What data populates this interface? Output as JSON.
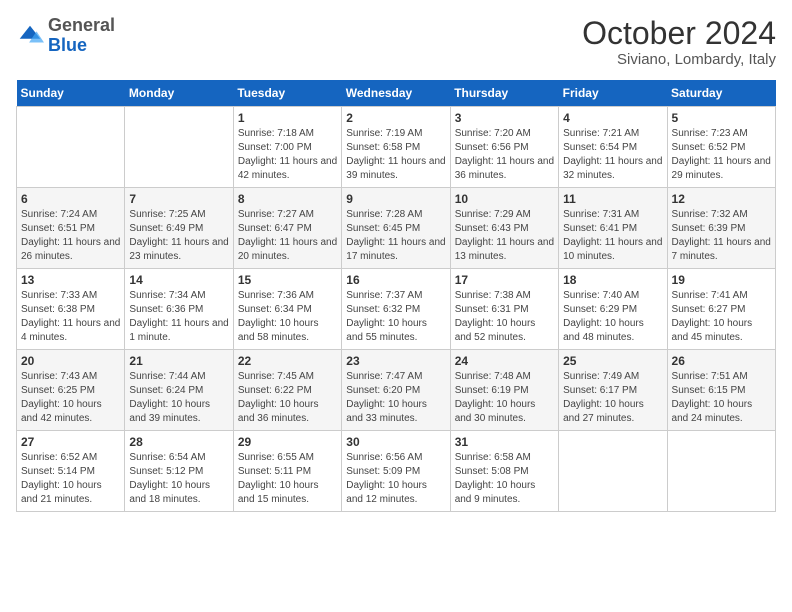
{
  "header": {
    "logo": {
      "general": "General",
      "blue": "Blue"
    },
    "title": "October 2024",
    "location": "Siviano, Lombardy, Italy"
  },
  "days_of_week": [
    "Sunday",
    "Monday",
    "Tuesday",
    "Wednesday",
    "Thursday",
    "Friday",
    "Saturday"
  ],
  "weeks": [
    [
      {
        "day": "",
        "info": ""
      },
      {
        "day": "",
        "info": ""
      },
      {
        "day": "1",
        "info": "Sunrise: 7:18 AM\nSunset: 7:00 PM\nDaylight: 11 hours and 42 minutes."
      },
      {
        "day": "2",
        "info": "Sunrise: 7:19 AM\nSunset: 6:58 PM\nDaylight: 11 hours and 39 minutes."
      },
      {
        "day": "3",
        "info": "Sunrise: 7:20 AM\nSunset: 6:56 PM\nDaylight: 11 hours and 36 minutes."
      },
      {
        "day": "4",
        "info": "Sunrise: 7:21 AM\nSunset: 6:54 PM\nDaylight: 11 hours and 32 minutes."
      },
      {
        "day": "5",
        "info": "Sunrise: 7:23 AM\nSunset: 6:52 PM\nDaylight: 11 hours and 29 minutes."
      }
    ],
    [
      {
        "day": "6",
        "info": "Sunrise: 7:24 AM\nSunset: 6:51 PM\nDaylight: 11 hours and 26 minutes."
      },
      {
        "day": "7",
        "info": "Sunrise: 7:25 AM\nSunset: 6:49 PM\nDaylight: 11 hours and 23 minutes."
      },
      {
        "day": "8",
        "info": "Sunrise: 7:27 AM\nSunset: 6:47 PM\nDaylight: 11 hours and 20 minutes."
      },
      {
        "day": "9",
        "info": "Sunrise: 7:28 AM\nSunset: 6:45 PM\nDaylight: 11 hours and 17 minutes."
      },
      {
        "day": "10",
        "info": "Sunrise: 7:29 AM\nSunset: 6:43 PM\nDaylight: 11 hours and 13 minutes."
      },
      {
        "day": "11",
        "info": "Sunrise: 7:31 AM\nSunset: 6:41 PM\nDaylight: 11 hours and 10 minutes."
      },
      {
        "day": "12",
        "info": "Sunrise: 7:32 AM\nSunset: 6:39 PM\nDaylight: 11 hours and 7 minutes."
      }
    ],
    [
      {
        "day": "13",
        "info": "Sunrise: 7:33 AM\nSunset: 6:38 PM\nDaylight: 11 hours and 4 minutes."
      },
      {
        "day": "14",
        "info": "Sunrise: 7:34 AM\nSunset: 6:36 PM\nDaylight: 11 hours and 1 minute."
      },
      {
        "day": "15",
        "info": "Sunrise: 7:36 AM\nSunset: 6:34 PM\nDaylight: 10 hours and 58 minutes."
      },
      {
        "day": "16",
        "info": "Sunrise: 7:37 AM\nSunset: 6:32 PM\nDaylight: 10 hours and 55 minutes."
      },
      {
        "day": "17",
        "info": "Sunrise: 7:38 AM\nSunset: 6:31 PM\nDaylight: 10 hours and 52 minutes."
      },
      {
        "day": "18",
        "info": "Sunrise: 7:40 AM\nSunset: 6:29 PM\nDaylight: 10 hours and 48 minutes."
      },
      {
        "day": "19",
        "info": "Sunrise: 7:41 AM\nSunset: 6:27 PM\nDaylight: 10 hours and 45 minutes."
      }
    ],
    [
      {
        "day": "20",
        "info": "Sunrise: 7:43 AM\nSunset: 6:25 PM\nDaylight: 10 hours and 42 minutes."
      },
      {
        "day": "21",
        "info": "Sunrise: 7:44 AM\nSunset: 6:24 PM\nDaylight: 10 hours and 39 minutes."
      },
      {
        "day": "22",
        "info": "Sunrise: 7:45 AM\nSunset: 6:22 PM\nDaylight: 10 hours and 36 minutes."
      },
      {
        "day": "23",
        "info": "Sunrise: 7:47 AM\nSunset: 6:20 PM\nDaylight: 10 hours and 33 minutes."
      },
      {
        "day": "24",
        "info": "Sunrise: 7:48 AM\nSunset: 6:19 PM\nDaylight: 10 hours and 30 minutes."
      },
      {
        "day": "25",
        "info": "Sunrise: 7:49 AM\nSunset: 6:17 PM\nDaylight: 10 hours and 27 minutes."
      },
      {
        "day": "26",
        "info": "Sunrise: 7:51 AM\nSunset: 6:15 PM\nDaylight: 10 hours and 24 minutes."
      }
    ],
    [
      {
        "day": "27",
        "info": "Sunrise: 6:52 AM\nSunset: 5:14 PM\nDaylight: 10 hours and 21 minutes."
      },
      {
        "day": "28",
        "info": "Sunrise: 6:54 AM\nSunset: 5:12 PM\nDaylight: 10 hours and 18 minutes."
      },
      {
        "day": "29",
        "info": "Sunrise: 6:55 AM\nSunset: 5:11 PM\nDaylight: 10 hours and 15 minutes."
      },
      {
        "day": "30",
        "info": "Sunrise: 6:56 AM\nSunset: 5:09 PM\nDaylight: 10 hours and 12 minutes."
      },
      {
        "day": "31",
        "info": "Sunrise: 6:58 AM\nSunset: 5:08 PM\nDaylight: 10 hours and 9 minutes."
      },
      {
        "day": "",
        "info": ""
      },
      {
        "day": "",
        "info": ""
      }
    ]
  ]
}
